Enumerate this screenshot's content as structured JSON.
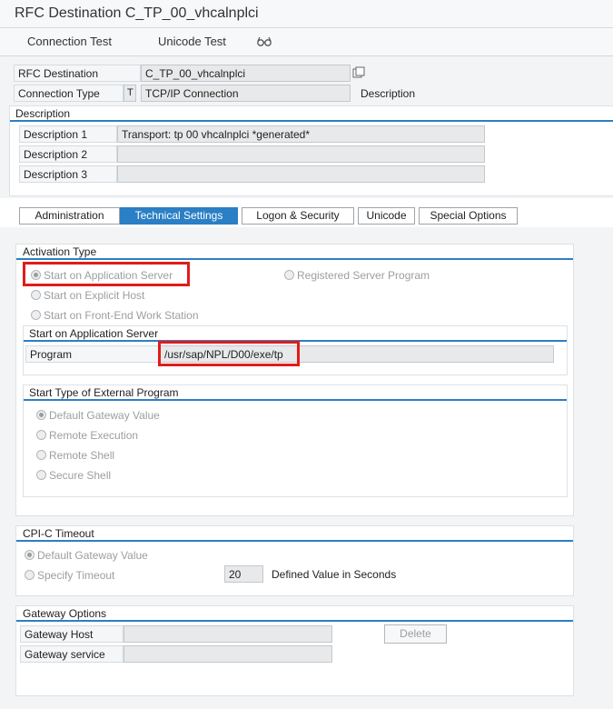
{
  "window": {
    "title": "RFC Destination C_TP_00_vhcalnplci"
  },
  "toolbar": {
    "connection_test": "Connection Test",
    "unicode_test": "Unicode Test"
  },
  "header": {
    "rfc_destination_label": "RFC Destination",
    "rfc_destination_value": "C_TP_00_vhcalnplci",
    "connection_type_label": "Connection Type",
    "connection_type_code": "T",
    "connection_type_value": "TCP/IP Connection",
    "description_label": "Description"
  },
  "description_section": {
    "title": "Description",
    "rows": [
      {
        "label": "Description 1",
        "value": "Transport: tp 00 vhcalnplci *generated*"
      },
      {
        "label": "Description 2",
        "value": ""
      },
      {
        "label": "Description 3",
        "value": ""
      }
    ]
  },
  "tabs": [
    {
      "label": "Administration",
      "active": false
    },
    {
      "label": "Technical Settings",
      "active": true
    },
    {
      "label": "Logon & Security",
      "active": false
    },
    {
      "label": "Unicode",
      "active": false
    },
    {
      "label": "Special Options",
      "active": false
    }
  ],
  "activation_type": {
    "title": "Activation Type",
    "options": [
      {
        "label": "Start on Application Server",
        "selected": true
      },
      {
        "label": "Registered Server Program",
        "selected": false
      },
      {
        "label": "Start on Explicit Host",
        "selected": false
      },
      {
        "label": "Start on Front-End Work Station",
        "selected": false
      }
    ],
    "app_server": {
      "title": "Start on Application Server",
      "program_label": "Program",
      "program_value": "/usr/sap/NPL/D00/exe/tp"
    },
    "start_type": {
      "title": "Start Type of External Program",
      "options": [
        {
          "label": "Default Gateway Value",
          "selected": true
        },
        {
          "label": "Remote Execution",
          "selected": false
        },
        {
          "label": "Remote Shell",
          "selected": false
        },
        {
          "label": "Secure Shell",
          "selected": false
        }
      ]
    }
  },
  "cpic_timeout": {
    "title": "CPI-C Timeout",
    "default_label": "Default Gateway Value",
    "specify_label": "Specify Timeout",
    "timeout_value": "20",
    "defined_label": "Defined Value in Seconds"
  },
  "gateway": {
    "title": "Gateway Options",
    "host_label": "Gateway Host",
    "host_value": "",
    "service_label": "Gateway service",
    "service_value": "",
    "delete_label": "Delete"
  },
  "colors": {
    "accent": "#2b7fc4",
    "highlight": "#e11b1b"
  }
}
